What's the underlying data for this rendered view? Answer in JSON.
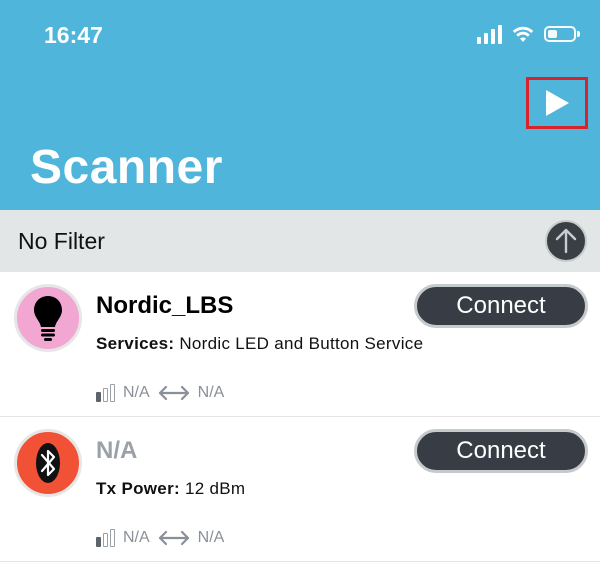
{
  "status_bar": {
    "time": "16:47"
  },
  "header": {
    "title": "Scanner",
    "scan_button_icon": "play-icon"
  },
  "filter": {
    "label": "No Filter",
    "toggle_icon": "arrow-up-circle-icon"
  },
  "devices": [
    {
      "name": "Nordic_LBS",
      "detail_key": "Services:",
      "detail_value": "Nordic LED and Button Service",
      "icon": "lightbulb-icon",
      "connect_label": "Connect",
      "rssi_label": "N/A",
      "interval_label": "N/A"
    },
    {
      "name": "N/A",
      "detail_key": "Tx Power:",
      "detail_value": "12 dBm",
      "icon": "bluetooth-icon",
      "connect_label": "Connect",
      "rssi_label": "N/A",
      "interval_label": "N/A"
    }
  ],
  "colors": {
    "header_bg": "#4fb5db",
    "filter_bg": "#e3e6e6",
    "button_bg": "#383d45",
    "highlight": "#d8232a",
    "avatar_lbs": "#f2a6d2",
    "avatar_ble": "#f15236"
  }
}
